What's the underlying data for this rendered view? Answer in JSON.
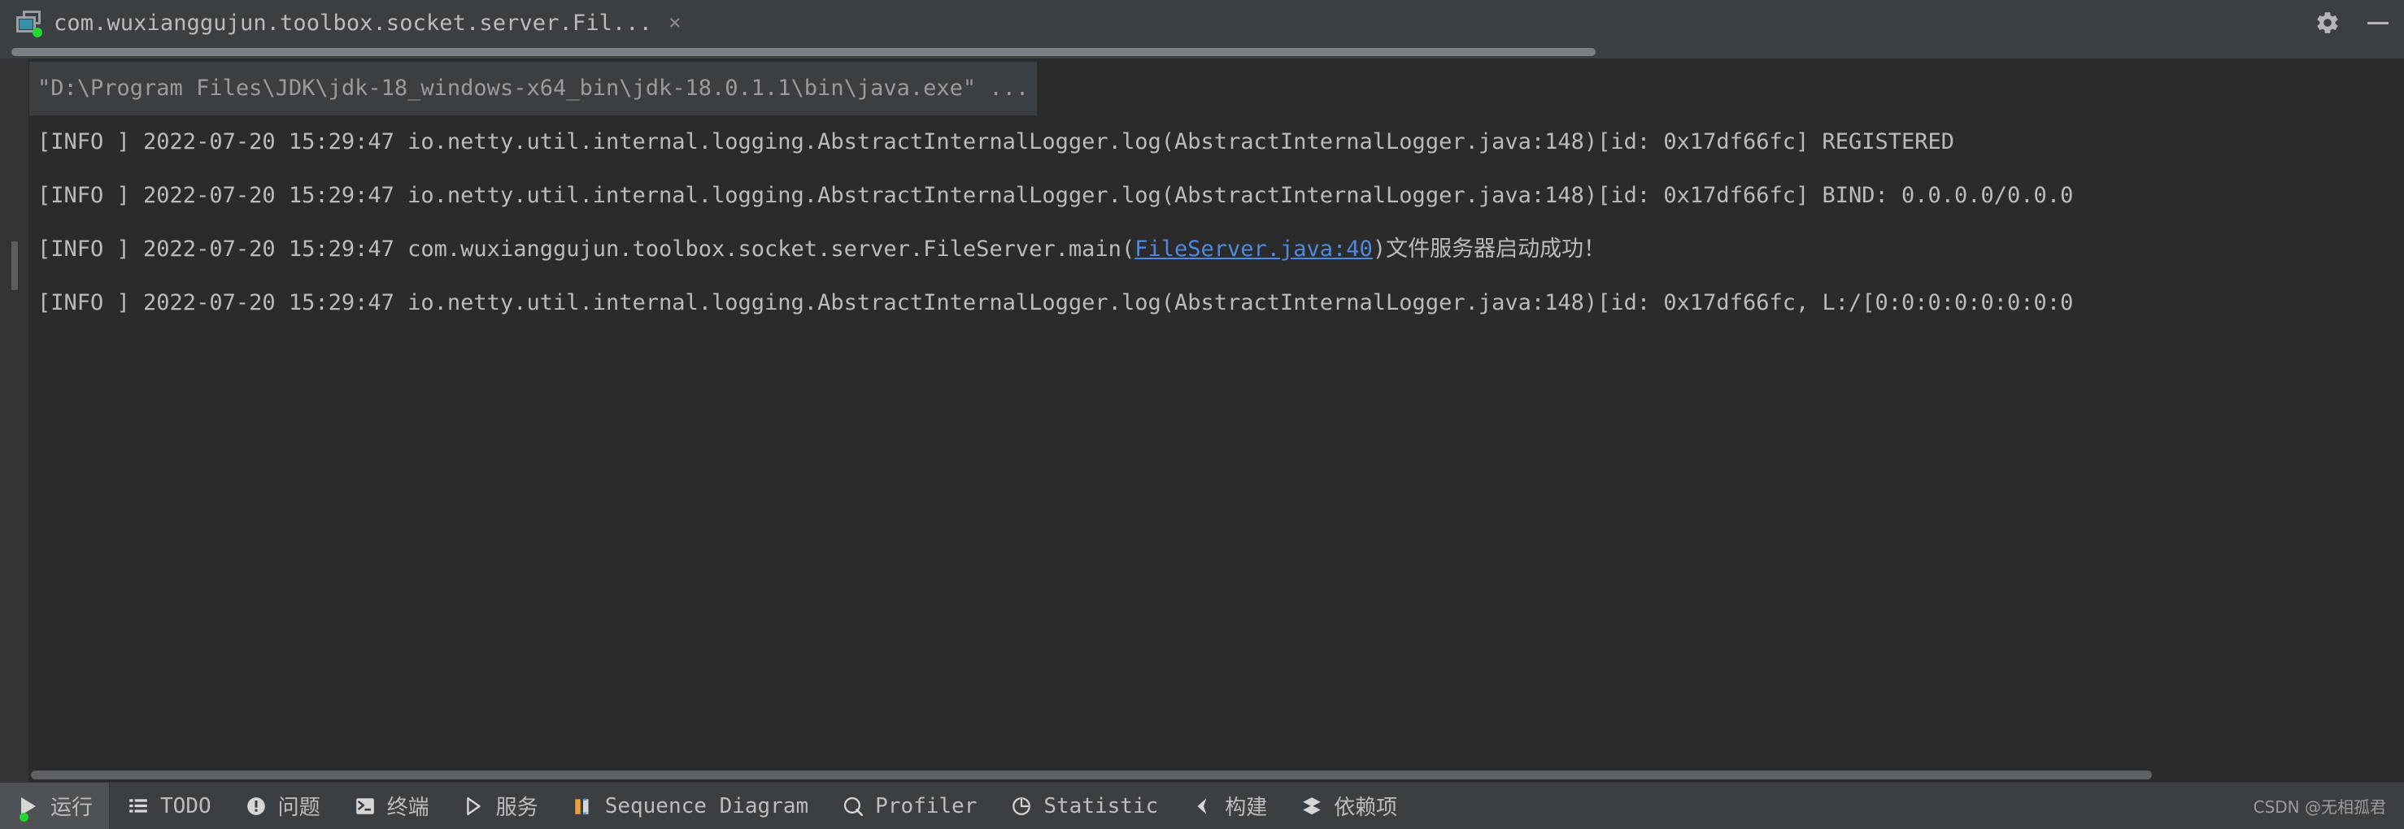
{
  "window": {
    "tab_title": "com.wuxianggujun.toolbox.socket.server.Fil...",
    "tab_close_label": "×",
    "tab_icon": "run-console-icon",
    "settings_icon": "gear-icon",
    "minimize_icon": "minimize-icon"
  },
  "console": {
    "command_line": "\"D:\\Program Files\\JDK\\jdk-18_windows-x64_bin\\jdk-18.0.1.1\\bin\\java.exe\" ...",
    "lines": [
      {
        "text": "[INFO ] 2022-07-20 15:29:47 io.netty.util.internal.logging.AbstractInternalLogger.log(AbstractInternalLogger.java:148)[id: 0x17df66fc] REGISTERED"
      },
      {
        "text": "[INFO ] 2022-07-20 15:29:47 io.netty.util.internal.logging.AbstractInternalLogger.log(AbstractInternalLogger.java:148)[id: 0x17df66fc] BIND: 0.0.0.0/0.0.0"
      },
      {
        "prefix": "[INFO ] 2022-07-20 15:29:47 com.wuxianggujun.toolbox.socket.server.FileServer.main(",
        "link": "FileServer.java:40",
        "suffix": ")文件服务器启动成功！"
      },
      {
        "text": "[INFO ] 2022-07-20 15:29:47 io.netty.util.internal.logging.AbstractInternalLogger.log(AbstractInternalLogger.java:148)[id: 0x17df66fc, L:/[0:0:0:0:0:0:0:0"
      }
    ]
  },
  "statusbar": {
    "items": [
      {
        "label": "运行",
        "icon": "run-icon",
        "active": true
      },
      {
        "label": "TODO",
        "icon": "todo-list-icon",
        "active": false
      },
      {
        "label": "问题",
        "icon": "problems-icon",
        "active": false
      },
      {
        "label": "终端",
        "icon": "terminal-icon",
        "active": false
      },
      {
        "label": "服务",
        "icon": "services-icon",
        "active": false
      },
      {
        "label": "Sequence Diagram",
        "icon": "sequence-diagram-icon",
        "active": false
      },
      {
        "label": "Profiler",
        "icon": "profiler-icon",
        "active": false
      },
      {
        "label": "Statistic",
        "icon": "statistic-icon",
        "active": false
      },
      {
        "label": "构建",
        "icon": "build-icon",
        "active": false
      },
      {
        "label": "依赖项",
        "icon": "dependencies-icon",
        "active": false
      }
    ],
    "watermark": "CSDN @无相孤君"
  },
  "colors": {
    "background": "#3c3f41",
    "console_bg": "#2b2b2b",
    "text": "#bbbbbb",
    "link": "#4f8ae0",
    "run_green": "#25d630",
    "accent_orange": "#e8a33d"
  }
}
